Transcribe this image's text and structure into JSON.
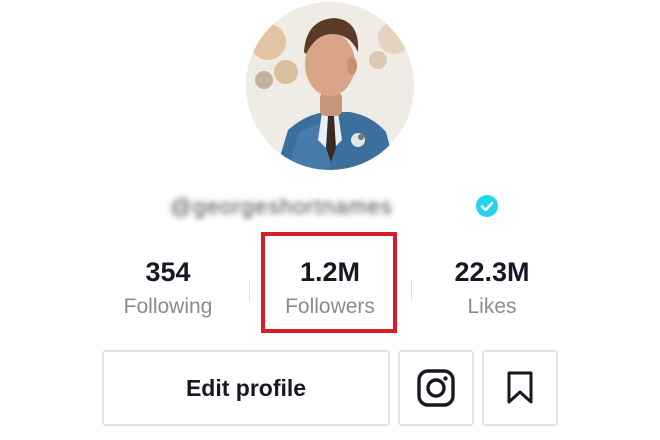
{
  "profile": {
    "username": "@georgeshortnames",
    "verified": true
  },
  "stats": {
    "following": {
      "value": "354",
      "label": "Following"
    },
    "followers": {
      "value": "1.2M",
      "label": "Followers"
    },
    "likes": {
      "value": "22.3M",
      "label": "Likes"
    }
  },
  "actions": {
    "edit_profile_label": "Edit profile",
    "instagram_icon": "instagram-icon",
    "bookmark_icon": "bookmark-icon"
  },
  "colors": {
    "highlight": "#d91c2a",
    "verified_badge": "#20d5ec",
    "label_gray": "#8a8b91"
  }
}
